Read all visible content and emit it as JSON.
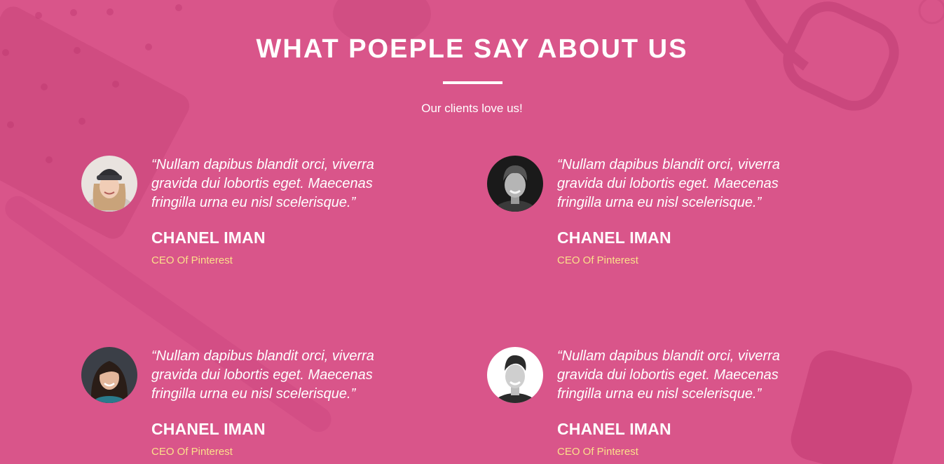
{
  "colors": {
    "background": "#d9558a",
    "text": "#ffffff",
    "role_accent": "#fbe08a"
  },
  "section": {
    "title": "WHAT POEPLE SAY ABOUT US",
    "subtitle": "Our clients love us!"
  },
  "testimonials": [
    {
      "quote": "“Nullam dapibus blandit orci, viverra gravida dui lobortis eget. Maecenas fringilla urna eu nisl scelerisque.”",
      "name": "CHANEL IMAN",
      "role": "CEO Of Pinterest",
      "avatar_icon": "avatar-woman-beanie"
    },
    {
      "quote": "“Nullam dapibus blandit orci, viverra gravida dui lobortis eget. Maecenas fringilla urna eu nisl scelerisque.”",
      "name": "CHANEL IMAN",
      "role": "CEO Of Pinterest",
      "avatar_icon": "avatar-man-curly-hair"
    },
    {
      "quote": "“Nullam dapibus blandit orci, viverra gravida dui lobortis eget. Maecenas fringilla urna eu nisl scelerisque.”",
      "name": "CHANEL IMAN",
      "role": "CEO Of Pinterest",
      "avatar_icon": "avatar-woman-dark-hair"
    },
    {
      "quote": "“Nullam dapibus blandit orci, viverra gravida dui lobortis eget. Maecenas fringilla urna eu nisl scelerisque.”",
      "name": "CHANEL IMAN",
      "role": "CEO Of Pinterest",
      "avatar_icon": "avatar-man-smiling"
    }
  ]
}
